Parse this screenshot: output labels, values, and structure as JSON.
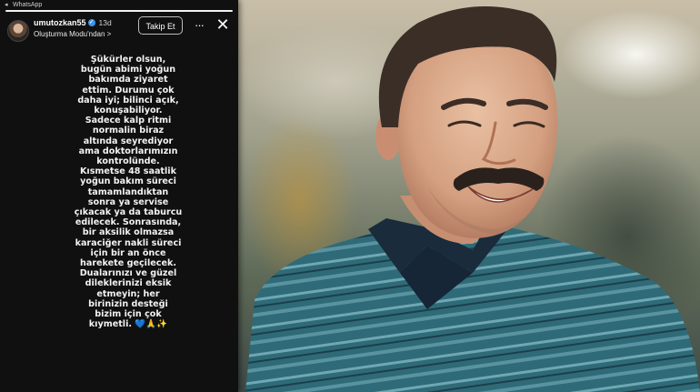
{
  "status_bar": {
    "back_arrow": "◂",
    "app_name": "WhatsApp"
  },
  "story": {
    "username": "umutozkan55",
    "verified_badge": "✓",
    "time_ago": "13d",
    "subtitle": "Oluşturma Modu'ndan >",
    "follow_button": "Takip Et",
    "more_menu": "···",
    "close": "✕",
    "text_lines": [
      "Şükürler olsun,",
      "bugün abimi yoğun",
      "bakımda ziyaret",
      "ettim. Durumu çok",
      "daha iyi; bilinci açık,",
      "konuşabiliyor.",
      "Sadece kalp ritmi",
      "normalin biraz",
      "altında seyrediyor",
      "ama doktorlarımızın",
      "kontrolünde.",
      "Kısmetse 48 saatlik",
      "yoğun bakım süreci",
      "tamamlandıktan",
      "sonra ya servise",
      "çıkacak ya da taburcu",
      "edilecek. Sonrasında,",
      "bir aksilik olmazsa",
      "karaciğer nakli süreci",
      "için bir an önce",
      "harekete geçilecek.",
      "Dualarınızı ve güzel",
      "dileklerinizi eksik",
      "etmeyin; her",
      "birinizin desteği",
      "bizim için çok",
      "kıymetli. 💙🙏✨"
    ]
  },
  "colors": {
    "story_bg": "#101010",
    "verified": "#3897f0",
    "shirt_base": "#2f6a78",
    "shirt_stripe": "#6fa7b3"
  },
  "icons": {
    "avatar": "profile-avatar",
    "more": "more-options-icon",
    "close": "close-icon",
    "verified": "verified-badge-icon"
  }
}
